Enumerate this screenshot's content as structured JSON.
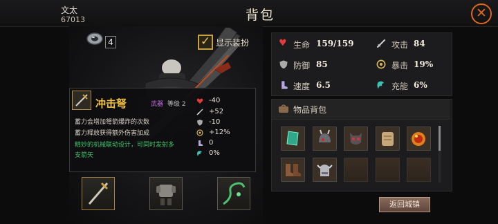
{
  "header": {
    "player_name": "文太",
    "player_id": "67013",
    "title": "背包"
  },
  "currency": {
    "gem_count": "4"
  },
  "outfit_toggle": {
    "label": "显示装扮",
    "checked": true
  },
  "item_card": {
    "name": "冲击弩",
    "type": "武器",
    "level": "等级 2",
    "desc_line1": "蓄力会增加弩箭爆炸的次数",
    "desc_line2": "蓄力释放获得额外伤害加成",
    "desc_special": "精妙的机械联动设计，可同时发射多支箭矢",
    "stats": [
      {
        "icon": "heart-icon",
        "value": "-40"
      },
      {
        "icon": "sword-icon",
        "value": "+52"
      },
      {
        "icon": "shield-icon",
        "value": "-10"
      },
      {
        "icon": "crit-icon",
        "value": "+12%"
      },
      {
        "icon": "boot-icon",
        "value": "0"
      },
      {
        "icon": "charge-icon",
        "value": "0%"
      }
    ]
  },
  "stats": {
    "hp_label": "生命",
    "hp_value": "159/159",
    "atk_label": "攻击",
    "atk_value": "84",
    "def_label": "防御",
    "def_value": "85",
    "crit_label": "暴击",
    "crit_value": "19%",
    "speed_label": "速度",
    "speed_value": "6.5",
    "charge_label": "充能",
    "charge_value": "6%"
  },
  "inventory": {
    "title": "物品背包"
  },
  "return_button": "返回城镇",
  "colors": {
    "accent_orange": "#e0661e",
    "item_gold": "#f0c044",
    "type_purple": "#c06ae0",
    "special_green": "#3ec06a"
  }
}
